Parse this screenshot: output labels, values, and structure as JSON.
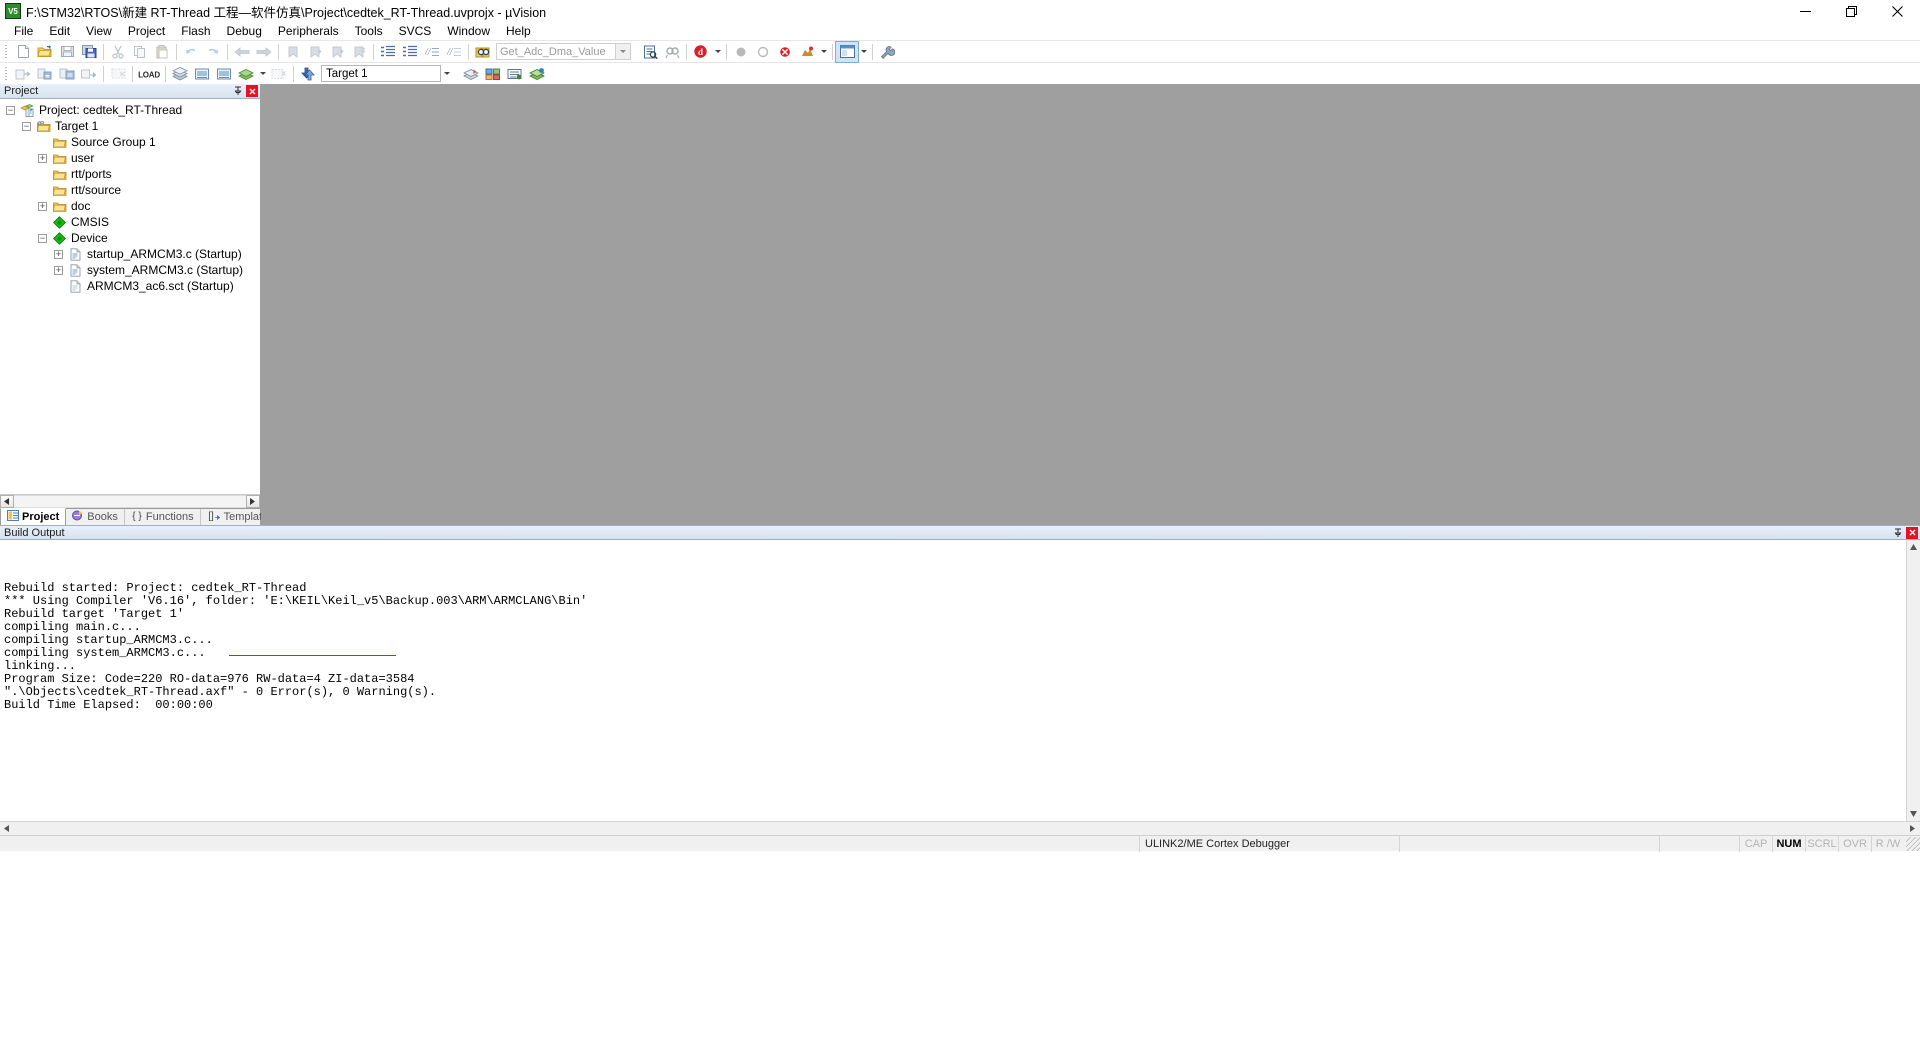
{
  "window": {
    "title": "F:\\STM32\\RTOS\\新建 RT-Thread 工程—软件仿真\\Project\\cedtek_RT-Thread.uvprojx - µVision",
    "app_icon_label": "µV5",
    "minimize_label": "Minimize",
    "maximize_label": "Restore",
    "close_label": "Close"
  },
  "menubar": {
    "items": [
      {
        "label": "File"
      },
      {
        "label": "Edit"
      },
      {
        "label": "View"
      },
      {
        "label": "Project"
      },
      {
        "label": "Flash"
      },
      {
        "label": "Debug"
      },
      {
        "label": "Peripherals"
      },
      {
        "label": "Tools"
      },
      {
        "label": "SVCS"
      },
      {
        "label": "Window"
      },
      {
        "label": "Help"
      }
    ]
  },
  "toolbar_file": {
    "buttons": [
      {
        "name": "new-file-icon",
        "tooltip": "New"
      },
      {
        "name": "open-file-icon",
        "tooltip": "Open"
      },
      {
        "name": "save-icon",
        "tooltip": "Save"
      },
      {
        "name": "save-all-icon",
        "tooltip": "Save All"
      },
      {
        "name": "cut-icon",
        "tooltip": "Cut"
      },
      {
        "name": "copy-icon",
        "tooltip": "Copy"
      },
      {
        "name": "paste-icon",
        "tooltip": "Paste"
      },
      {
        "name": "undo-icon",
        "tooltip": "Undo"
      },
      {
        "name": "redo-icon",
        "tooltip": "Redo"
      },
      {
        "name": "navigate-back-icon",
        "tooltip": "Back"
      },
      {
        "name": "navigate-forward-icon",
        "tooltip": "Forward"
      },
      {
        "name": "bookmark-toggle-icon",
        "tooltip": "Insert/Remove Bookmark"
      },
      {
        "name": "bookmark-prev-icon",
        "tooltip": "Previous Bookmark"
      },
      {
        "name": "bookmark-next-icon",
        "tooltip": "Next Bookmark"
      },
      {
        "name": "bookmark-clear-icon",
        "tooltip": "Clear All Bookmarks"
      },
      {
        "name": "indent-right-icon",
        "tooltip": "Indent"
      },
      {
        "name": "indent-left-icon",
        "tooltip": "Outdent"
      },
      {
        "name": "comment-icon",
        "tooltip": "Comment Selection"
      },
      {
        "name": "uncomment-icon",
        "tooltip": "Uncomment Selection"
      },
      {
        "name": "find-in-files-icon",
        "tooltip": "Find in Files"
      }
    ],
    "search": {
      "value": "Get_Adc_Dma_Value",
      "placeholder": "Get_Adc_Dma_Value"
    },
    "after_search": [
      {
        "name": "find-icon",
        "tooltip": "Find"
      },
      {
        "name": "browse-symbol-icon",
        "tooltip": "Browse Symbol"
      },
      {
        "name": "debug-session-icon",
        "tooltip": "Start/Stop Debug Session"
      }
    ],
    "right": [
      {
        "name": "breakpoint-disable-icon",
        "tooltip": "Disable Breakpoint"
      },
      {
        "name": "breakpoint-icon",
        "tooltip": "Insert/Remove Breakpoint"
      },
      {
        "name": "breakpoint-kill-all-icon",
        "tooltip": "Kill All Breakpoints"
      },
      {
        "name": "configuration-wizard-icon",
        "tooltip": "Configuration Wizard"
      },
      {
        "name": "window-layout-icon",
        "tooltip": "Window Layout"
      },
      {
        "name": "configure-tools-icon",
        "tooltip": "Configure Tools"
      }
    ]
  },
  "toolbar_build": {
    "buttons": [
      {
        "name": "translate-icon",
        "tooltip": "Translate Current File"
      },
      {
        "name": "build-icon",
        "tooltip": "Build"
      },
      {
        "name": "rebuild-icon",
        "tooltip": "Rebuild"
      },
      {
        "name": "batch-build-icon",
        "tooltip": "Batch Build"
      },
      {
        "name": "stop-build-icon",
        "tooltip": "Stop Build"
      }
    ],
    "load_label": "LOAD",
    "target_value": "Target 1",
    "after_target": [
      {
        "name": "target-options-icon",
        "tooltip": "Options for Target"
      },
      {
        "name": "manage-project-items-icon",
        "tooltip": "Manage Project Items"
      },
      {
        "name": "pack-installer-icon",
        "tooltip": "Pack Installer"
      },
      {
        "name": "manage-run-time-env-icon",
        "tooltip": "Manage Run-Time Environment"
      },
      {
        "name": "select-software-packs-icon",
        "tooltip": "Select Software Packs"
      }
    ]
  },
  "project_panel": {
    "caption": "Project",
    "pin_label": "Auto Hide",
    "close_label": "Close",
    "tree": [
      {
        "label": "Project: cedtek_RT-Thread",
        "indent": 0,
        "expander": "-",
        "icon": "project-icon"
      },
      {
        "label": "Target 1",
        "indent": 1,
        "expander": "-",
        "icon": "target-folder-icon"
      },
      {
        "label": "Source Group 1",
        "indent": 2,
        "expander": "",
        "icon": "folder-icon"
      },
      {
        "label": "user",
        "indent": 2,
        "expander": "+",
        "icon": "folder-icon"
      },
      {
        "label": "rtt/ports",
        "indent": 2,
        "expander": "",
        "icon": "folder-icon"
      },
      {
        "label": "rtt/source",
        "indent": 2,
        "expander": "",
        "icon": "folder-icon"
      },
      {
        "label": "doc",
        "indent": 2,
        "expander": "+",
        "icon": "folder-icon"
      },
      {
        "label": "CMSIS",
        "indent": 2,
        "expander": "",
        "icon": "component-icon"
      },
      {
        "label": "Device",
        "indent": 2,
        "expander": "-",
        "icon": "component-icon"
      },
      {
        "label": "startup_ARMCM3.c (Startup)",
        "indent": 3,
        "expander": "+",
        "icon": "c-file-icon"
      },
      {
        "label": "system_ARMCM3.c (Startup)",
        "indent": 3,
        "expander": "+",
        "icon": "c-file-icon"
      },
      {
        "label": "ARMCM3_ac6.sct (Startup)",
        "indent": 3,
        "expander": "",
        "icon": "sct-file-icon"
      }
    ],
    "tabs": [
      {
        "label": "Project",
        "icon": "project-tab-icon",
        "active": true
      },
      {
        "label": "Books",
        "icon": "books-tab-icon",
        "active": false
      },
      {
        "label": "Functions",
        "icon": "functions-tab-icon",
        "active": false
      },
      {
        "label": "Templates",
        "icon": "templates-tab-icon",
        "active": false
      }
    ],
    "scroll_left_label": "◄",
    "scroll_right_label": "►"
  },
  "build_output": {
    "caption": "Build Output",
    "pin_label": "Auto Hide",
    "close_label": "Close",
    "lines": [
      "Rebuild started: Project: cedtek_RT-Thread",
      "*** Using Compiler 'V6.16', folder: 'E:\\KEIL\\Keil_v5\\Backup.003\\ARM\\ARMCLANG\\Bin'",
      "Rebuild target 'Target 1'",
      "compiling main.c...",
      "compiling startup_ARMCM3.c...",
      "compiling system_ARMCM3.c...",
      "linking...",
      "Program Size: Code=220 RO-data=976 RW-data=4 ZI-data=3584",
      "\".\\Objects\\cedtek_RT-Thread.axf\" - 0 Error(s), 0 Warning(s).",
      "Build Time Elapsed:  00:00:00"
    ],
    "annotation_color": "#e02020",
    "annotation_target": "0 Error(s), 0 Warning(s)."
  },
  "statusbar": {
    "left_text": "",
    "debugger": "ULINK2/ME Cortex Debugger",
    "indicators": [
      {
        "label": "CAP",
        "active": false
      },
      {
        "label": "NUM",
        "active": true
      },
      {
        "label": "SCRL",
        "active": false
      },
      {
        "label": "OVR",
        "active": false
      },
      {
        "label": "R /W",
        "active": false
      }
    ]
  },
  "colors": {
    "editor_bg": "#9f9f9f",
    "caption_bg": "#dbe6f2",
    "accent_red": "#e02020",
    "folder_yellow": "#f5c242",
    "component_green": "#22c022"
  }
}
